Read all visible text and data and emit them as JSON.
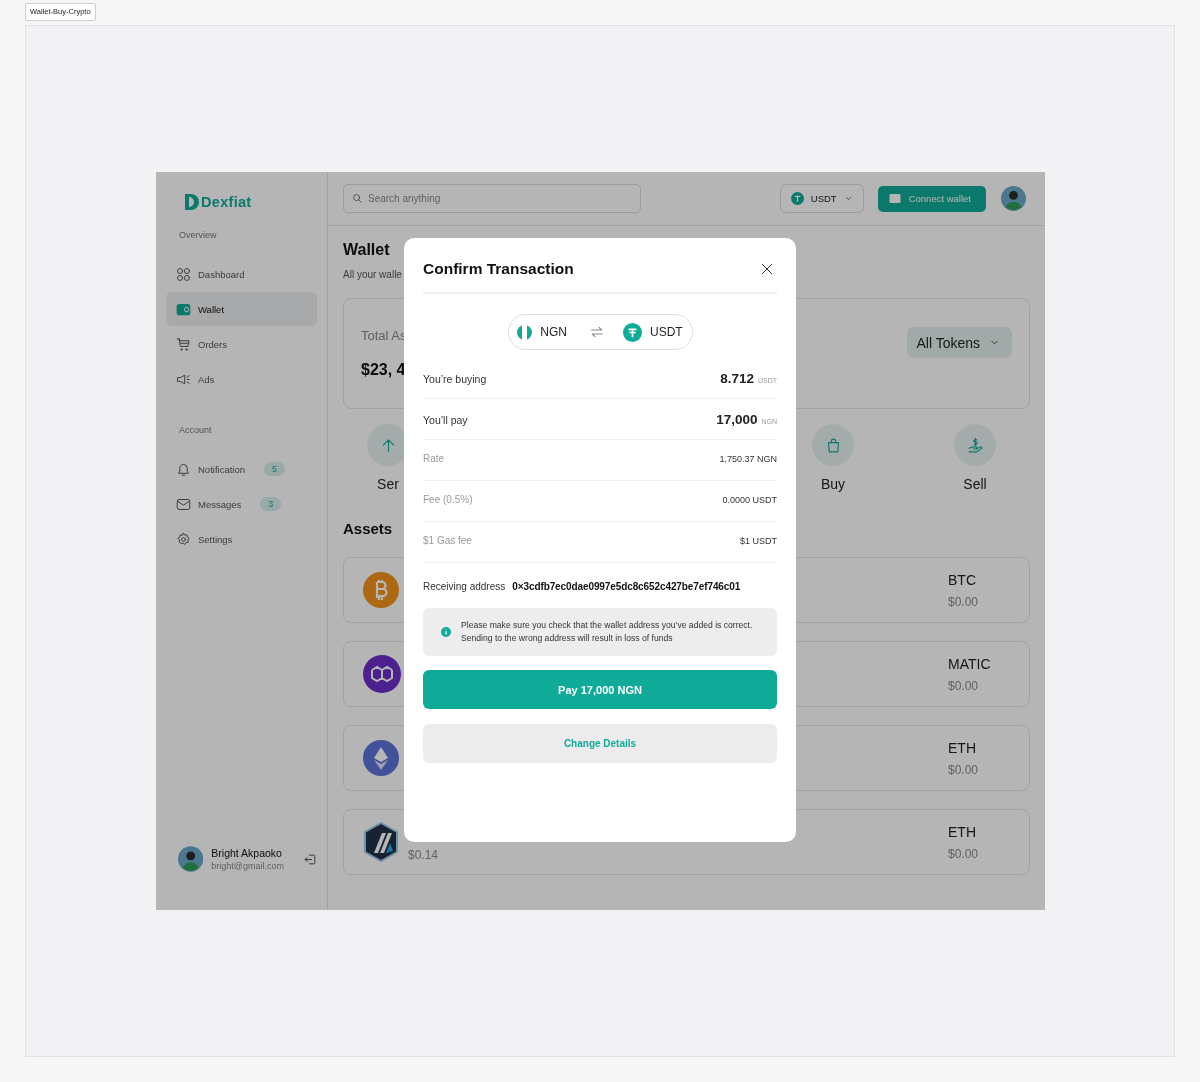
{
  "frame_label": "Wallet-Buy-Crypto",
  "sidebar": {
    "logo": "Dexfiat",
    "sections": [
      {
        "title": "Overview",
        "items": [
          {
            "label": "Dashboard",
            "selected": false
          },
          {
            "label": "Wallet",
            "selected": true
          },
          {
            "label": "Orders",
            "selected": false
          },
          {
            "label": "Ads",
            "selected": false
          }
        ]
      },
      {
        "title": "Account",
        "items": [
          {
            "label": "Notification",
            "selected": false,
            "badge": "5"
          },
          {
            "label": "Messages",
            "selected": false,
            "badge": "3"
          },
          {
            "label": "Settings",
            "selected": false
          }
        ]
      }
    ],
    "user": {
      "name": "Bright Akpaoko",
      "email": "bright@gmail.com"
    }
  },
  "topbar": {
    "search": {
      "placeholder": "Search anything"
    },
    "currency": "USDT",
    "connect_button": "Connect wallet"
  },
  "wallet": {
    "title": "Wallet",
    "subtitle": "All your walle",
    "total_label": "Total As",
    "total_amount": "$23, 4",
    "filter": "All Tokens",
    "actions": [
      {
        "label": "Ser"
      },
      {
        "label": "Buy"
      },
      {
        "label": "Sell"
      }
    ],
    "assets_title": "Assets",
    "assets": [
      {
        "symbol": "BTC",
        "value": "$0.00"
      },
      {
        "symbol": "MATIC",
        "value": "$0.00"
      },
      {
        "symbol": "ETH",
        "value": "$0.00"
      },
      {
        "price": "$0.14",
        "symbol": "ETH",
        "value": "$0.00"
      }
    ]
  },
  "modal": {
    "title": "Confirm Transaction",
    "pair": {
      "from": "NGN",
      "to": "USDT"
    },
    "rows": [
      {
        "kind": "amount",
        "label": "You’re buying",
        "value": "8.712",
        "unit": "USDT"
      },
      {
        "kind": "amount",
        "label": "You’ll pay",
        "value": "17,000",
        "unit": "NGN"
      },
      {
        "kind": "detail",
        "label": "Rate",
        "value": "1,750.37 NGN"
      },
      {
        "kind": "detail",
        "label": "Fee (0.5%)",
        "value": "0.0000 USDT"
      },
      {
        "kind": "detail",
        "label": "$1 Gas fee",
        "value": "$1 USDT"
      }
    ],
    "address": {
      "label": "Receiving address",
      "value": "0×3cdfb7ec0dae0997e5dc8c652c427be7ef746c01"
    },
    "note": "Please make sure you check that the wallet address you’ve added is correct. Sending to the wrong address will result in loss of funds",
    "pay_button": "Pay 17,000 NGN",
    "change_button": "Change Details"
  }
}
